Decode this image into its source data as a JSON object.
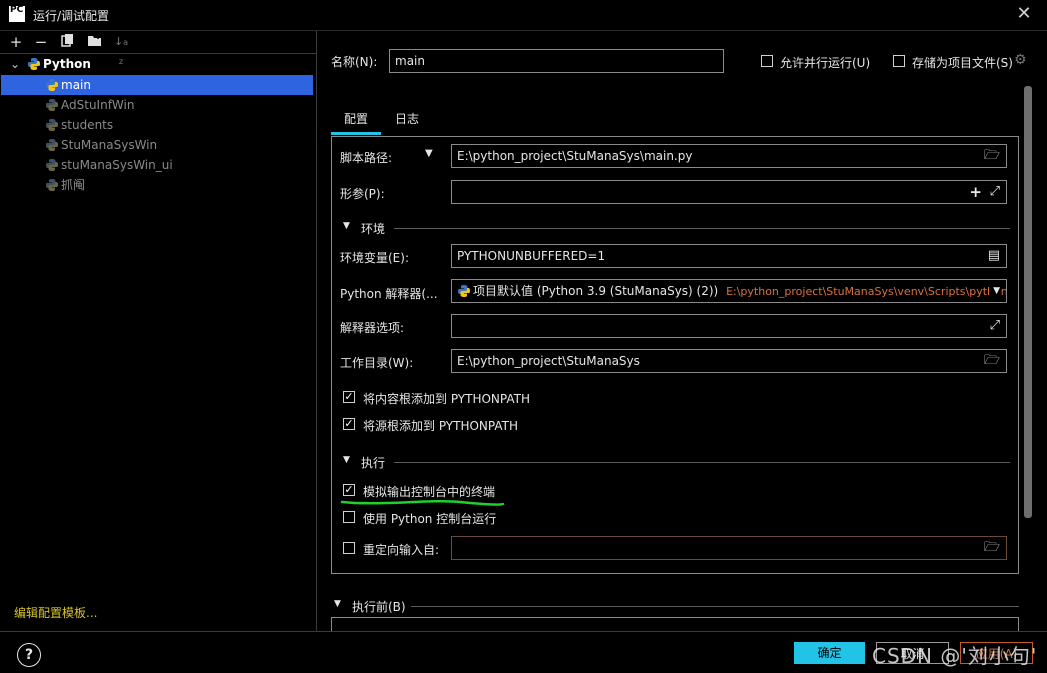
{
  "window": {
    "title": "运行/调试配置",
    "app_icon": "PC",
    "close_icon": "close-icon"
  },
  "toolbar": {
    "add": "+",
    "remove": "−",
    "copy": "copy-icon",
    "folder": "new-folder-icon",
    "sort": "sort-icon"
  },
  "tree": {
    "group": "Python",
    "items": [
      "main",
      "AdStuInfWin",
      "students",
      "StuManaSysWin",
      "stuManaSysWin_ui",
      "抓阄"
    ],
    "selected": "main"
  },
  "edit_templates": "编辑配置模板...",
  "header": {
    "name_label": "名称(N):",
    "name_value": "main",
    "allow_parallel": "允许并行运行(U)",
    "store_as_file": "存储为项目文件(S)"
  },
  "tabs": [
    "配置",
    "日志"
  ],
  "config": {
    "script_path_label": "脚本路径:",
    "script_path_value": "E:\\python_project\\StuManaSys\\main.py",
    "params_label": "形参(P):",
    "params_value": "",
    "env_section": "环境",
    "env_vars_label": "环境变量(E):",
    "env_vars_value": "PYTHONUNBUFFERED=1",
    "interpreter_label": "Python 解释器(...",
    "interpreter_value": "项目默认值 (Python 3.9 (StuManaSys) (2))",
    "interpreter_path": "E:\\python_project\\StuManaSys\\venv\\Scripts\\python",
    "interp_options_label": "解释器选项:",
    "interp_options_value": "",
    "workdir_label": "工作目录(W):",
    "workdir_value": "E:\\python_project\\StuManaSys",
    "add_content_roots": "将内容根添加到 PYTHONPATH",
    "add_source_roots": "将源根添加到 PYTHONPATH",
    "exec_section": "执行",
    "emulate_terminal": "模拟输出控制台中的终端",
    "use_python_console": "使用 Python 控制台运行",
    "redirect_input": "重定向输入自:",
    "redirect_input_value": "",
    "before_launch": "执行前(B)"
  },
  "checkbox_states": {
    "allow_parallel": false,
    "store_as_file": false,
    "add_content_roots": true,
    "add_source_roots": true,
    "emulate_terminal": true,
    "use_python_console": false,
    "redirect_input": false
  },
  "footer": {
    "help": "?",
    "ok": "确定",
    "cancel": "取消",
    "apply": "应用(A)"
  },
  "watermark": "CSDN @'刘小句'",
  "colors": {
    "accent": "#22c3e6",
    "selection": "#2f64e0",
    "link": "#d7c32b",
    "path_orange": "#d9733a",
    "annotation_green": "#1fd12a"
  }
}
